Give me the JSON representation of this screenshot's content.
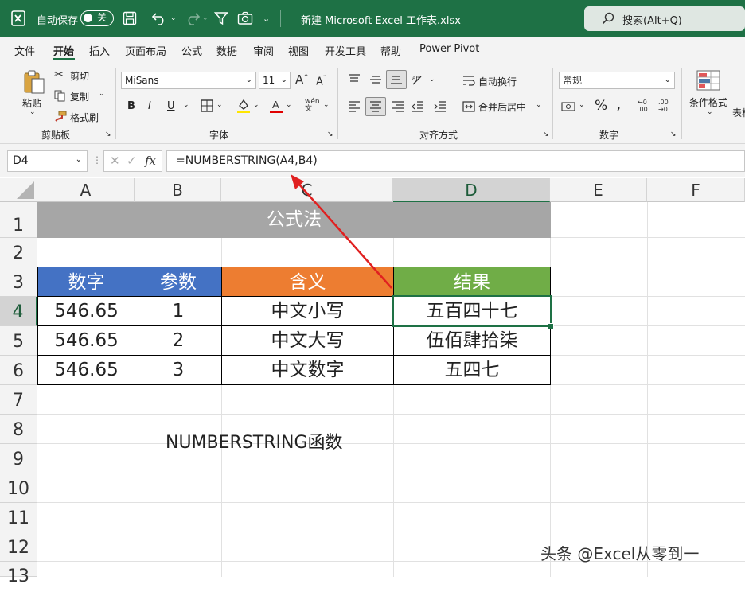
{
  "titlebar": {
    "autosave_label": "自动保存",
    "autosave_state": "关",
    "filename": "新建 Microsoft Excel 工作表.xlsx",
    "search_placeholder": "搜索(Alt+Q)"
  },
  "menu": {
    "items": [
      "文件",
      "开始",
      "插入",
      "页面布局",
      "公式",
      "数据",
      "审阅",
      "视图",
      "开发工具",
      "帮助",
      "Power Pivot"
    ],
    "active": "开始"
  },
  "ribbon": {
    "clipboard": {
      "paste": "粘贴",
      "cut": "剪切",
      "copy": "复制",
      "format_painter": "格式刷",
      "group": "剪贴板"
    },
    "font": {
      "name": "MiSans",
      "size": "11",
      "bold": "B",
      "italic": "I",
      "underline": "U",
      "group": "字体"
    },
    "alignment": {
      "wrap": "自动换行",
      "merge": "合并后居中",
      "group": "对齐方式"
    },
    "number": {
      "format": "常规",
      "group": "数字"
    },
    "styles": {
      "conditional": "条件格式",
      "table": "表格"
    }
  },
  "formula_bar": {
    "name_box": "D4",
    "formula": "=NUMBERSTRING(A4,B4)",
    "fx": "fx"
  },
  "sheet": {
    "columns": [
      "A",
      "B",
      "C",
      "D",
      "E",
      "F"
    ],
    "rows": [
      "1",
      "2",
      "3",
      "4",
      "5",
      "6",
      "7",
      "8",
      "9",
      "10",
      "11",
      "12",
      "13"
    ],
    "selected_cell": "D4",
    "title": "公式法",
    "headers": [
      "数字",
      "参数",
      "含义",
      "结果"
    ],
    "data": [
      [
        "546.65",
        "1",
        "中文小写",
        "五百四十七"
      ],
      [
        "546.65",
        "2",
        "中文大写",
        "伍佰肆拾柒"
      ],
      [
        "546.65",
        "3",
        "中文数字",
        "五四七"
      ]
    ],
    "note": "NUMBERSTRING函数"
  },
  "colors": {
    "excel_green": "#1e7145",
    "title_fill": "#a6a6a6",
    "header_blue": "#4472c4",
    "header_orange": "#ed7d31",
    "header_green": "#70ad47",
    "arrow": "#e02020"
  },
  "watermark": "头条 @Excel从零到一"
}
